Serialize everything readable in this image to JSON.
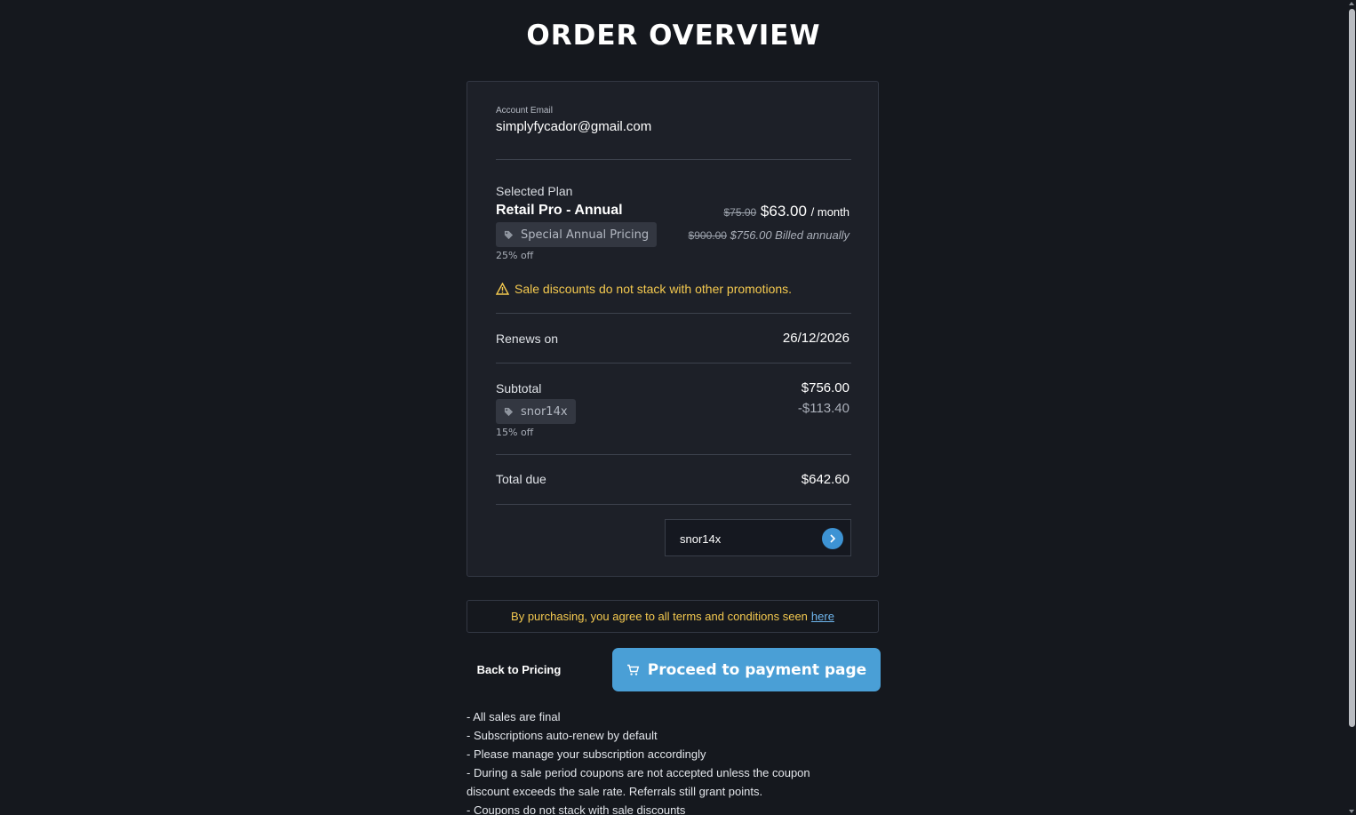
{
  "page": {
    "title": "ORDER OVERVIEW"
  },
  "account": {
    "label": "Account Email",
    "email": "simplyfycador@gmail.com"
  },
  "plan": {
    "label": "Selected Plan",
    "name": "Retail Pro - Annual",
    "monthly_old": "$75.00",
    "monthly_new": "$63.00",
    "monthly_unit": "/ month",
    "annual_old": "$900.00",
    "annual_new": "$756.00 Billed annually",
    "promo_tag": "Special Annual Pricing",
    "promo_pct": "25% off",
    "tag_icon": "tag-icon"
  },
  "warning": {
    "icon": "warning-triangle-icon",
    "text": "Sale discounts do not stack with other promotions."
  },
  "renewal": {
    "label": "Renews on",
    "date": "26/12/2026"
  },
  "subtotal": {
    "label": "Subtotal",
    "value": "$756.00",
    "discount": "-$113.40",
    "coupon_tag": "snor14x",
    "coupon_pct": "15% off"
  },
  "total": {
    "label": "Total due",
    "value": "$642.60"
  },
  "coupon_input": {
    "value": "snor14x",
    "button_icon": "chevron-right-icon"
  },
  "terms": {
    "text": "By purchasing, you agree to all terms and conditions seen",
    "link": "here"
  },
  "actions": {
    "back": "Back to Pricing",
    "proceed": "Proceed to payment page",
    "proceed_icon": "cart-icon"
  },
  "notes": [
    "- All sales are final",
    "- Subscriptions auto-renew by default",
    "- Please manage your subscription accordingly",
    "- During a sale period coupons are not accepted unless the coupon discount exceeds the sale rate. Referrals still grant points.",
    "- Coupons do not stack with sale discounts"
  ],
  "colors": {
    "accent": "#4a9fd6",
    "warning": "#f4c94f",
    "background": "#15181e",
    "card": "#1d2028"
  }
}
